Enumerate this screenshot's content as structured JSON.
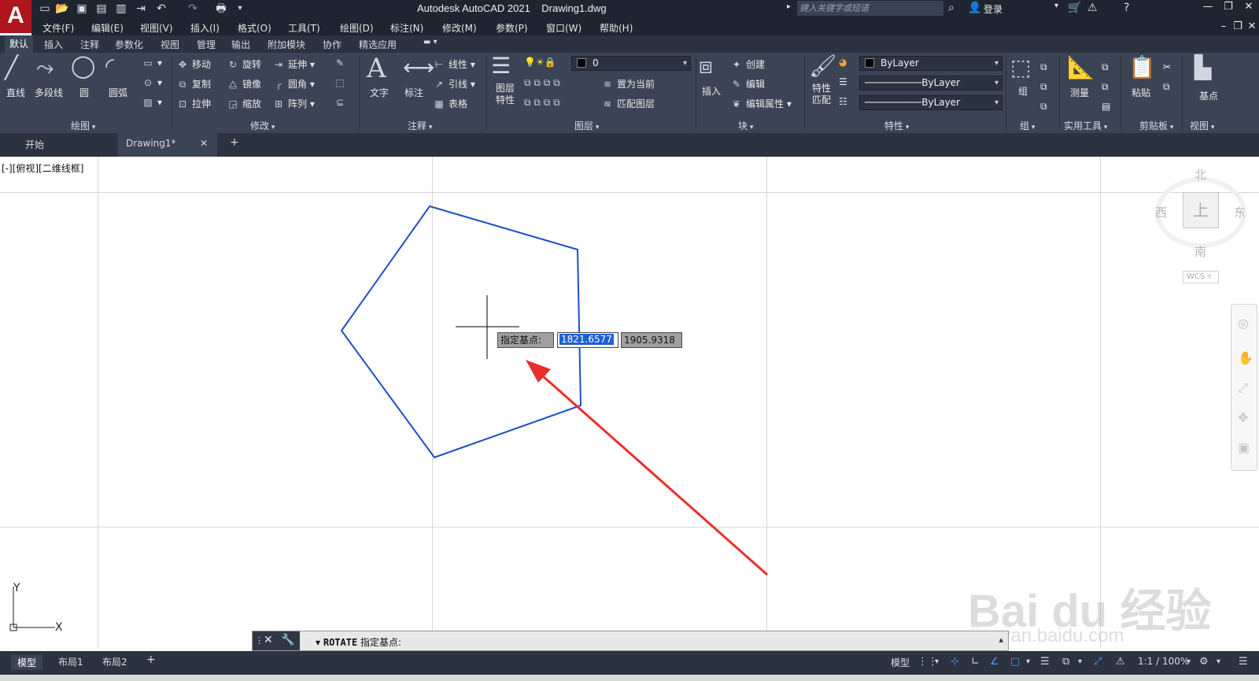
{
  "app": {
    "logo_letter": "A",
    "title": "Autodesk AutoCAD 2021    Drawing1.dwg",
    "search_placeholder": "键入关键字或短语",
    "login_label": "登录"
  },
  "menu": [
    "文件(F)",
    "编辑(E)",
    "视图(V)",
    "插入(I)",
    "格式(O)",
    "工具(T)",
    "绘图(D)",
    "标注(N)",
    "修改(M)",
    "参数(P)",
    "窗口(W)",
    "帮助(H)"
  ],
  "ribbon_tabs": [
    "默认",
    "插入",
    "注释",
    "参数化",
    "视图",
    "管理",
    "输出",
    "附加模块",
    "协作",
    "精选应用"
  ],
  "ribbon": {
    "draw": {
      "title": "绘图",
      "line": "直线",
      "polyline": "多段线",
      "circle": "圆",
      "arc": "圆弧"
    },
    "modify": {
      "title": "修改",
      "move": "移动",
      "rotate": "旋转",
      "trim": "延伸",
      "copy": "复制",
      "mirror": "镜像",
      "fillet": "圆角",
      "stretch": "拉伸",
      "scale": "缩放",
      "array": "阵列"
    },
    "annotation": {
      "title": "注释",
      "text": "文字",
      "dimension": "标注",
      "linear": "线性",
      "leader": "引线",
      "table": "表格"
    },
    "layers": {
      "title": "图层",
      "layer_properties": "图层\n特性",
      "current_layer": "0",
      "set_current": "置为当前",
      "match_layer": "匹配图层"
    },
    "block": {
      "title": "块",
      "insert": "插入",
      "create": "创建",
      "edit": "编辑",
      "edit_attributes": "编辑属性"
    },
    "properties": {
      "title": "特性",
      "match_properties": "特性\n匹配",
      "color": "ByLayer",
      "linetype": "ByLayer",
      "lineweight": "ByLayer"
    },
    "groups": {
      "title": "组",
      "group": "组"
    },
    "utilities": {
      "title": "实用工具",
      "measure": "测量"
    },
    "clipboard": {
      "title": "剪贴板",
      "paste": "粘贴"
    },
    "view": {
      "title": "视图",
      "base": "基点"
    }
  },
  "file_tabs": {
    "start": "开始",
    "drawing": "Drawing1*"
  },
  "viewport": {
    "label": "[-][俯视][二维线框]",
    "viewcube": {
      "north": "北",
      "south": "南",
      "east": "东",
      "west": "西",
      "top": "上",
      "wcs": "WCS"
    },
    "ucs": {
      "x": "X",
      "y": "Y"
    }
  },
  "dynamic_input": {
    "prompt": "指定基点:",
    "x_value": "1821.6577",
    "y_value": "1905.9318"
  },
  "command_line": {
    "command": "ROTATE",
    "prompt": "指定基点:"
  },
  "status": {
    "layout_tabs": [
      "模型",
      "布局1",
      "布局2"
    ],
    "model_label": "模型",
    "scale": "1:1 / 100%"
  },
  "watermark": {
    "text": "Bai du 经验",
    "url": "jingyan.baidu.com"
  },
  "colors": {
    "dark_bg": "#1f2530",
    "ribbon_bg": "#3b4455",
    "pentagon_stroke": "#1e4fc2",
    "arrow": "#e8302b",
    "logo_red": "#b0141c"
  }
}
